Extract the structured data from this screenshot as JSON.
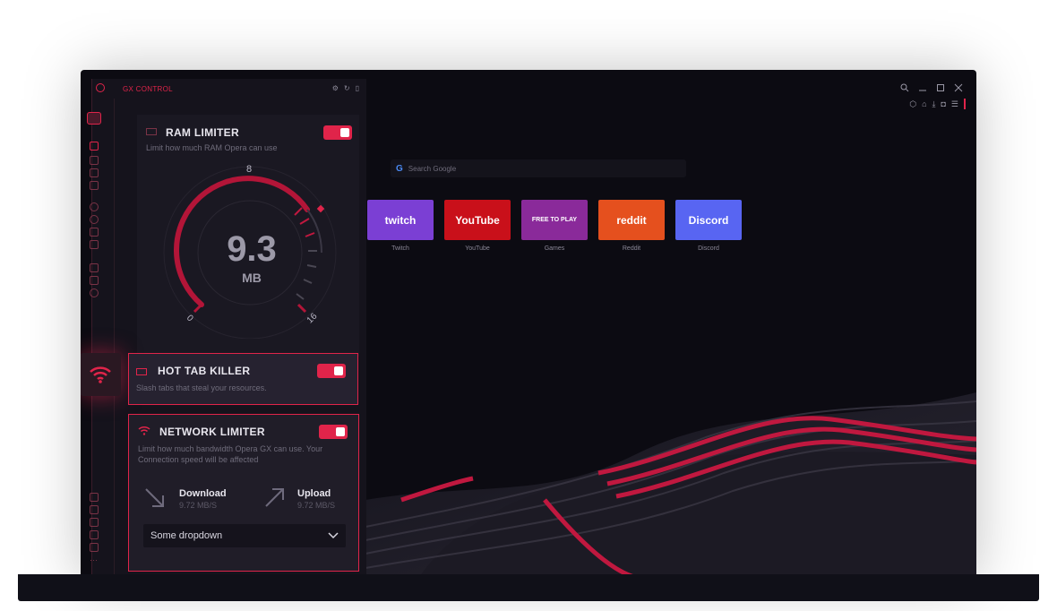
{
  "panel": {
    "title": "GX CONTROL"
  },
  "ram": {
    "title": "RAM LIMITER",
    "subtitle": "Limit how much RAM Opera can use",
    "value": "9.3",
    "unit": "MB",
    "scale_min": "0",
    "scale_mid": "8",
    "scale_max": "16",
    "enabled": true
  },
  "hot_tab": {
    "title": "HOT TAB KILLER",
    "subtitle": "Slash tabs that steal your resources.",
    "enabled": true
  },
  "network": {
    "title": "NETWORK LIMITER",
    "subtitle_line1": "Limit how much bandwidth Opera GX can use. Your",
    "subtitle_line2": "Connection speed will be affected",
    "download_label": "Download",
    "download_value": "9.72 MB/S",
    "upload_label": "Upload",
    "upload_value": "9.72 MB/S",
    "dropdown_value": "Some dropdown",
    "enabled": true
  },
  "browser": {
    "search_placeholder": "Search Google",
    "speed_dials": [
      {
        "label": "Twitch",
        "brand": "twitch",
        "color": "#7b3fd4"
      },
      {
        "label": "YouTube",
        "brand": "YouTube",
        "color": "#c9101a"
      },
      {
        "label": "Games",
        "brand": "FREE TO PLAY",
        "color": "#8a2a9a"
      },
      {
        "label": "Reddit",
        "brand": "reddit",
        "color": "#e5501e"
      },
      {
        "label": "Discord",
        "brand": "Discord",
        "color": "#5865f2"
      }
    ]
  },
  "colors": {
    "accent": "#e0244a",
    "panel": "#15131c",
    "card": "#201d28"
  }
}
